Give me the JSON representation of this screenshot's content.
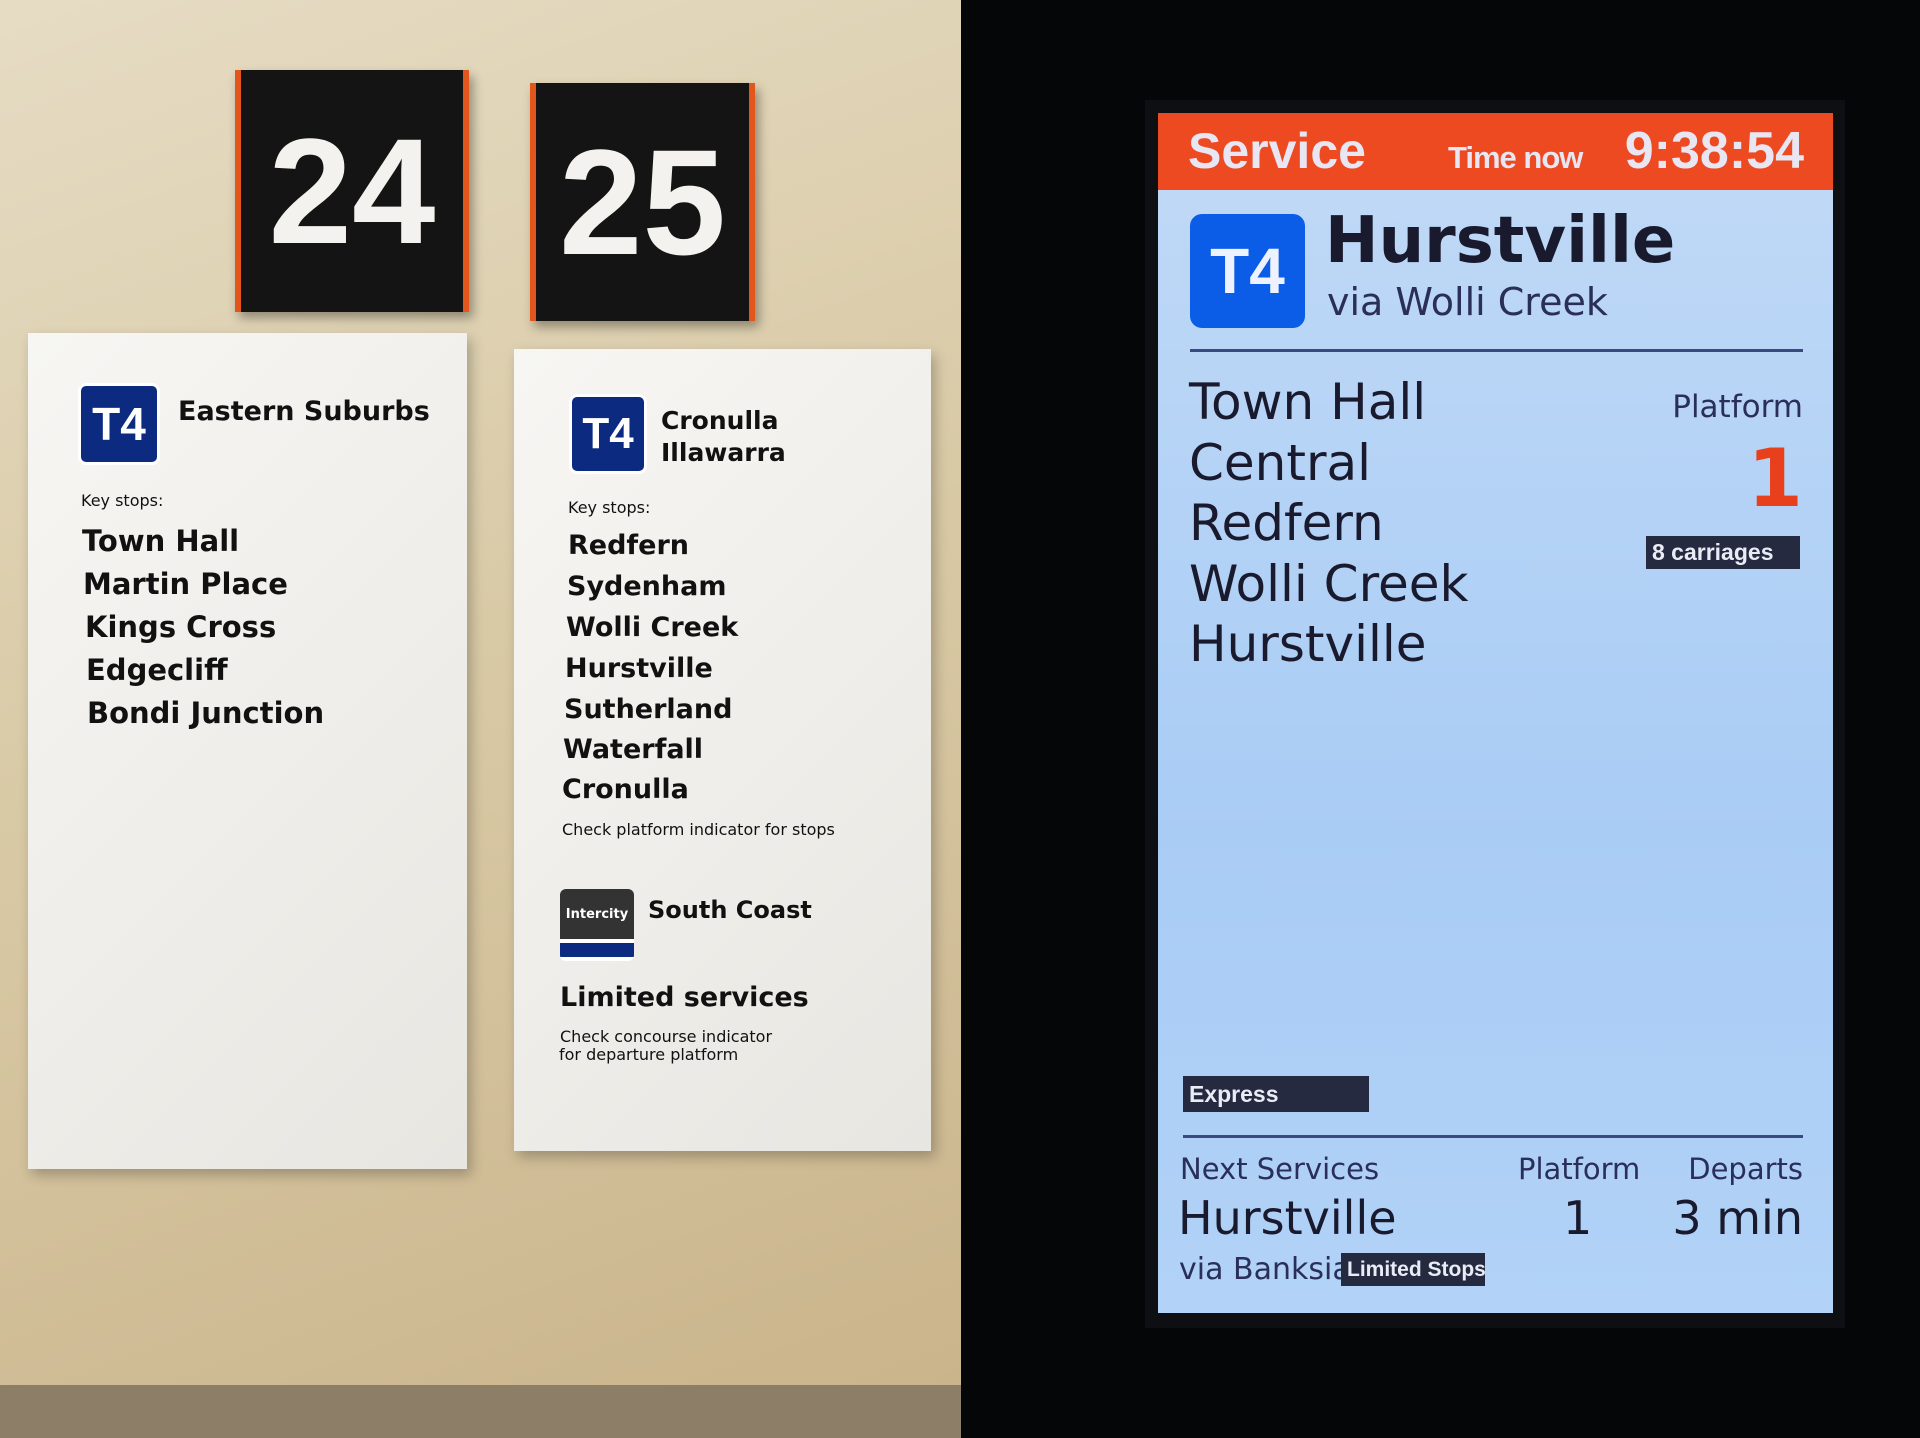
{
  "platform_numbers": [
    "24",
    "25"
  ],
  "signs": [
    {
      "line": "T4",
      "name": "Eastern Suburbs",
      "key_stops_label": "Key stops:",
      "stops": [
        "Town Hall",
        "Martin Place",
        "Kings Cross",
        "Edgecliff",
        "Bondi Junction"
      ]
    },
    {
      "line": "T4",
      "name_line1": "Cronulla",
      "name_line2": "Illawarra",
      "key_stops_label": "Key stops:",
      "stops": [
        "Redfern",
        "Sydenham",
        "Wolli Creek",
        "Hurstville",
        "Sutherland",
        "Waterfall",
        "Cronulla"
      ],
      "note": "Check platform indicator for stops",
      "intercity_badge": "Intercity",
      "intercity_name": "South Coast",
      "limited": "Limited services",
      "limited_note_line1": "Check concourse indicator",
      "limited_note_line2": "for departure platform"
    }
  ],
  "display": {
    "header": {
      "service": "Service",
      "time_now_label": "Time now",
      "time": "9:38:54"
    },
    "line": "T4",
    "destination": "Hurstville",
    "via": "via Wolli Creek",
    "stops": [
      "Town Hall",
      "Central",
      "Redfern",
      "Wolli Creek",
      "Hurstville"
    ],
    "platform_label": "Platform",
    "platform": "1",
    "carriages": "8 carriages",
    "service_type": "Express",
    "next": {
      "header": "Next Services",
      "platform_header": "Platform",
      "departs_header": "Departs",
      "destination": "Hurstville",
      "platform": "1",
      "departs": "3 min",
      "via": "via Banksia",
      "tag": "Limited Stops"
    }
  },
  "colors": {
    "header_orange": "#ee4a22",
    "t4_blue": "#0b5ce6",
    "platform_red": "#e8401c",
    "screen_bg": "#b8d4f6"
  }
}
